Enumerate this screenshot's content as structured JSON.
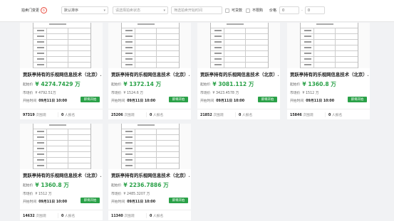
{
  "filters": {
    "region_label": "拍卖门变更",
    "region_badge": "6",
    "sort_label": "默认排序",
    "status_placeholder": "请选择拍卖状态",
    "date_placeholder": "筛选拍卖开始时间",
    "loan_label": "可贷款",
    "limit_label": "不限购",
    "price_label": "价格",
    "price_min": "0",
    "price_sep": "-",
    "price_max": "0"
  },
  "cards": [
    {
      "title": "贾跃亭持有的乐视网信息技术（北京）...",
      "start_label": "起拍价",
      "price": "¥ 4274.7429 万",
      "market_label": "市场价",
      "market": "¥ 4792.51万",
      "time_label": "开拍时间",
      "time": "09月11日 10:00",
      "status": "即将开拍",
      "views": "97319",
      "views_label": "次围观",
      "applicants": "0",
      "applicants_label": "人报名"
    },
    {
      "title": "贾跃亭持有的乐视网信息技术（北京）...",
      "start_label": "起拍价",
      "price": "¥ 1372.14 万",
      "market_label": "市场价",
      "market": "¥ 1524.6 万",
      "time_label": "开拍时间",
      "time": "09月11日 10:00",
      "status": "即将开拍",
      "views": "25206",
      "views_label": "次围观",
      "applicants": "0",
      "applicants_label": "人报名"
    },
    {
      "title": "贾跃亭持有的乐视网信息技术（北京）...",
      "start_label": "起拍价",
      "price": "¥ 3081.112 万",
      "market_label": "市场价",
      "market": "¥ 3423.4578 万",
      "time_label": "开拍时间",
      "time": "09月11日 10:00",
      "status": "即将开拍",
      "views": "21852",
      "views_label": "次围观",
      "applicants": "0",
      "applicants_label": "人报名"
    },
    {
      "title": "贾跃亭持有的乐视网信息技术（北京）...",
      "start_label": "起拍价",
      "price": "¥ 1360.8 万",
      "market_label": "市场价",
      "market": "¥ 1512 万",
      "time_label": "开拍时间",
      "time": "09月11日 10:00",
      "status": "即将开拍",
      "views": "15846",
      "views_label": "次围观",
      "applicants": "0",
      "applicants_label": "人报名"
    },
    {
      "title": "贾跃亭持有的乐视网信息技术（北京）...",
      "start_label": "起拍价",
      "price": "¥ 1360.8 万",
      "market_label": "市场价",
      "market": "¥ 1512 万",
      "time_label": "开拍时间",
      "time": "09月11日 10:00",
      "status": "即将开拍",
      "views": "14632",
      "views_label": "次围观",
      "applicants": "0",
      "applicants_label": "人报名"
    },
    {
      "title": "贾跃亭持有的乐视网信息技术（北京）...",
      "start_label": "起拍价",
      "price": "¥ 2236.7886 万",
      "market_label": "市场价",
      "market": "¥ 2485.3207 万",
      "time_label": "开拍时间",
      "time": "09月11日 10:00",
      "status": "即将开拍",
      "views": "11340",
      "views_label": "次围观",
      "applicants": "0",
      "applicants_label": "人报名"
    }
  ]
}
